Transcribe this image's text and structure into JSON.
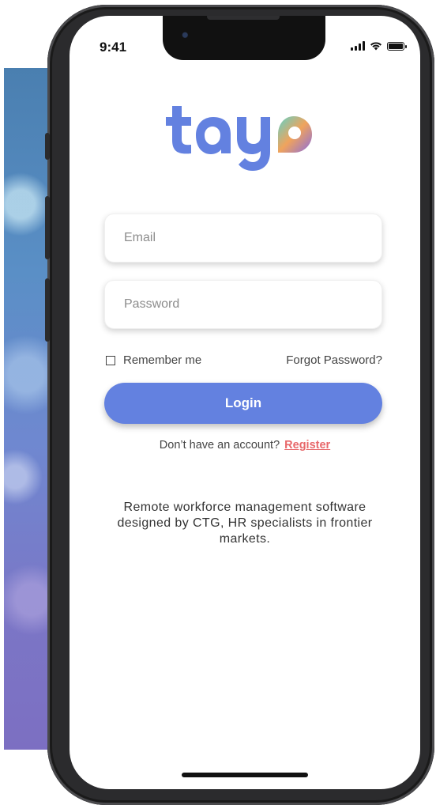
{
  "status_bar": {
    "time": "9:41"
  },
  "brand": {
    "logo_text": "tayo",
    "primary_color": "#6381e0",
    "accent_color": "#e8686a"
  },
  "form": {
    "email_placeholder": "Email",
    "password_placeholder": "Password",
    "remember_label": "Remember me",
    "forgot_label": "Forgot Password?",
    "login_label": "Login",
    "signup_prompt": "Don’t have an account?",
    "register_label": "Register"
  },
  "tagline": "Remote workforce management software designed by CTG, HR specialists in frontier markets.",
  "icons": [
    "signal-icon",
    "wifi-icon",
    "battery-icon",
    "checkbox-icon"
  ]
}
